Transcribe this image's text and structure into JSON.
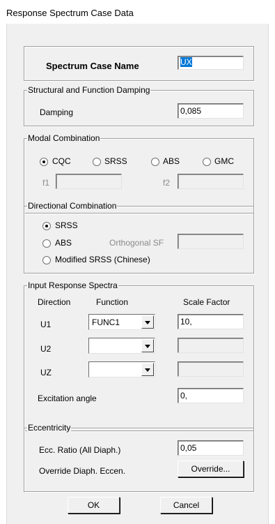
{
  "window": {
    "title": "Response Spectrum Case Data"
  },
  "case": {
    "label": "Spectrum Case Name",
    "value": "UX"
  },
  "damping": {
    "group": "Structural and Function Damping",
    "label": "Damping",
    "value": "0,085"
  },
  "modal": {
    "group": "Modal Combination",
    "options": [
      "CQC",
      "SRSS",
      "ABS",
      "GMC"
    ],
    "selected": "CQC",
    "f1_label": "f1",
    "f1_value": "",
    "f2_label": "f2",
    "f2_value": ""
  },
  "directional": {
    "group": "Directional Combination",
    "srss": "SRSS",
    "abs": "ABS",
    "modified": "Modified SRSS (Chinese)",
    "selected": "SRSS",
    "orth_label": "Orthogonal SF",
    "orth_value": ""
  },
  "input": {
    "group": "Input Response Spectra",
    "col_direction": "Direction",
    "col_function": "Function",
    "col_scale": "Scale Factor",
    "rows": [
      {
        "dir": "U1",
        "func": "FUNC1",
        "scale": "10,"
      },
      {
        "dir": "U2",
        "func": "",
        "scale": ""
      },
      {
        "dir": "UZ",
        "func": "",
        "scale": ""
      }
    ],
    "angle_label": "Excitation  angle",
    "angle_value": "0,"
  },
  "eccentricity": {
    "group": "Eccentricity",
    "ratio_label": "Ecc. Ratio (All Diaph.)",
    "ratio_value": "0,05",
    "override_label": "Override Diaph. Eccen.",
    "override_button": "Override..."
  },
  "buttons": {
    "ok": "OK",
    "cancel": "Cancel"
  }
}
